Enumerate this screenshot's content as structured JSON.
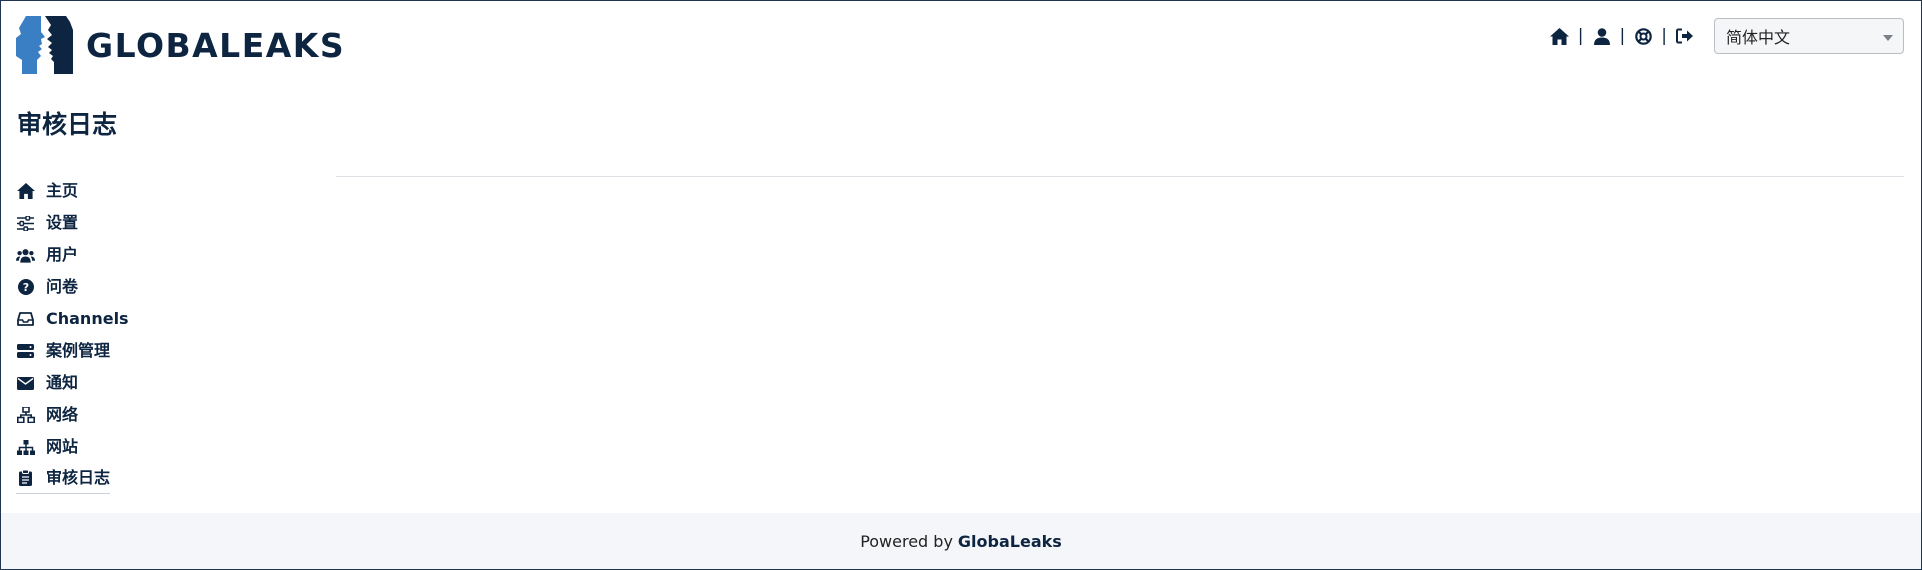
{
  "header": {
    "logo_text": "GLOBALEAKS",
    "toolbar": {
      "home_icon": "home-icon",
      "user_icon": "user-icon",
      "help_icon": "lifebuoy-icon",
      "logout_icon": "logout-icon",
      "separator": "|"
    },
    "language_select": {
      "value": "简体中文"
    }
  },
  "page": {
    "title": "审核日志"
  },
  "sidebar": {
    "items": [
      {
        "label": "主页",
        "icon": "home-icon"
      },
      {
        "label": "设置",
        "icon": "sliders-icon"
      },
      {
        "label": "用户",
        "icon": "users-icon"
      },
      {
        "label": "问卷",
        "icon": "question-circle-icon"
      },
      {
        "label": "Channels",
        "icon": "inbox-icon"
      },
      {
        "label": "案例管理",
        "icon": "server-icon"
      },
      {
        "label": "通知",
        "icon": "envelope-icon"
      },
      {
        "label": "网络",
        "icon": "network-icon"
      },
      {
        "label": "网站",
        "icon": "sitemap-icon"
      },
      {
        "label": "审核日志",
        "icon": "clipboard-icon"
      }
    ],
    "active_index": 9
  },
  "footer": {
    "powered_by": "Powered by",
    "brand": "GlobaLeaks"
  },
  "colors": {
    "primary": "#0e2541",
    "logo_light": "#3a7fc4",
    "footer_bg": "#f4f6f9"
  }
}
